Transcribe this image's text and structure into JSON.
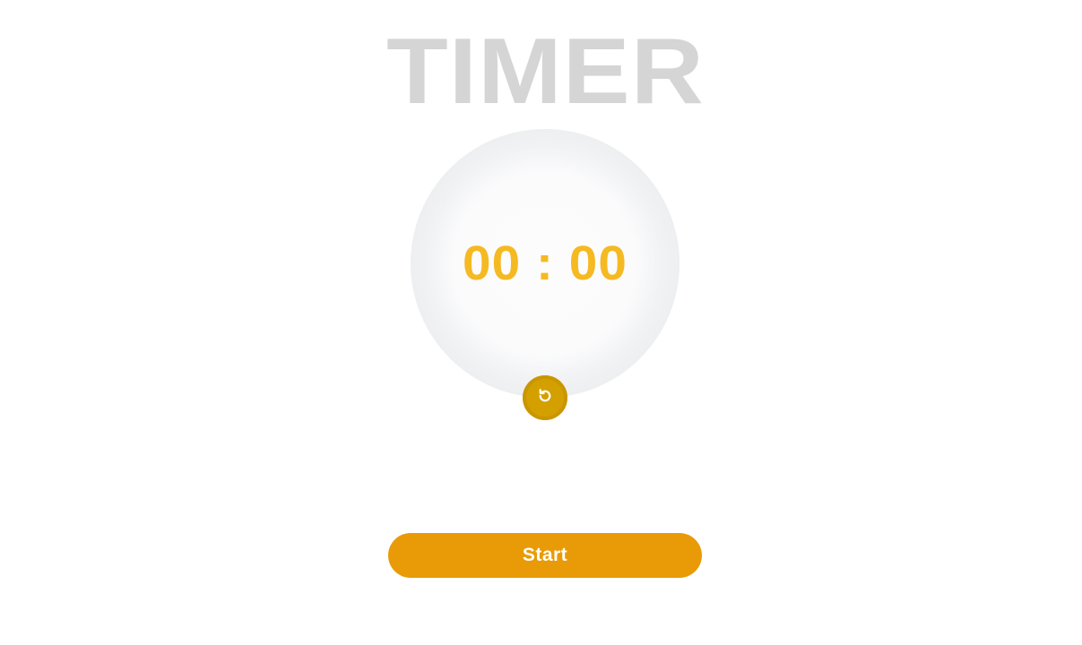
{
  "app": {
    "title": "TIMER"
  },
  "timer": {
    "display": "00 : 00"
  },
  "controls": {
    "reset_icon": "reset-icon",
    "start_label": "Start"
  },
  "colors": {
    "title": "#d5d5d6",
    "digits": "#f5b922",
    "reset_button": "#d4a000",
    "start_button": "#e89b06"
  }
}
